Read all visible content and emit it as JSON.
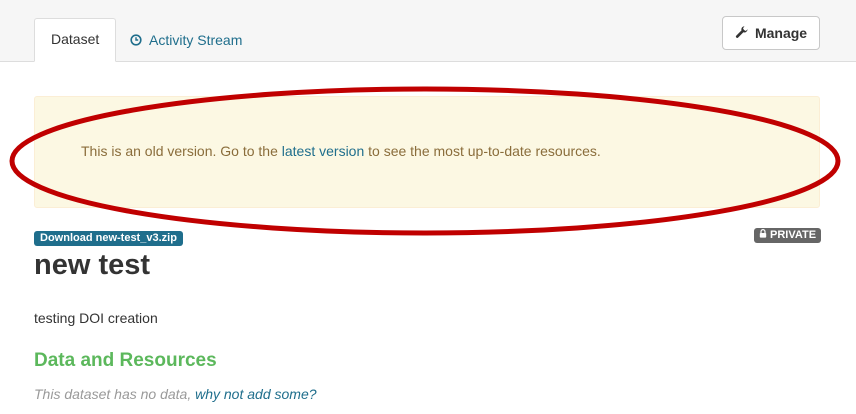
{
  "tabs": [
    {
      "label": "Dataset",
      "active": true
    },
    {
      "label": "Activity Stream",
      "icon": "clock-icon"
    }
  ],
  "manage_button": {
    "label": "Manage",
    "icon": "wrench-icon"
  },
  "alert": {
    "text_before": "This is an old version. Go to the ",
    "link_text": "latest version",
    "text_after": " to see the most up-to-date resources."
  },
  "download_badge": "Download new-test_v3.zip",
  "private_badge": {
    "label": "PRIVATE",
    "icon": "lock-icon"
  },
  "dataset": {
    "title": "new test",
    "description": "testing DOI creation"
  },
  "resources": {
    "heading": "Data and Resources",
    "empty_text": "This dataset has no data, ",
    "add_link": "why not add some?"
  },
  "colors": {
    "link": "#1f6e8c",
    "alert_bg": "#fcf8e3",
    "annotation": "#c00000",
    "heading_green": "#5cb85c"
  }
}
